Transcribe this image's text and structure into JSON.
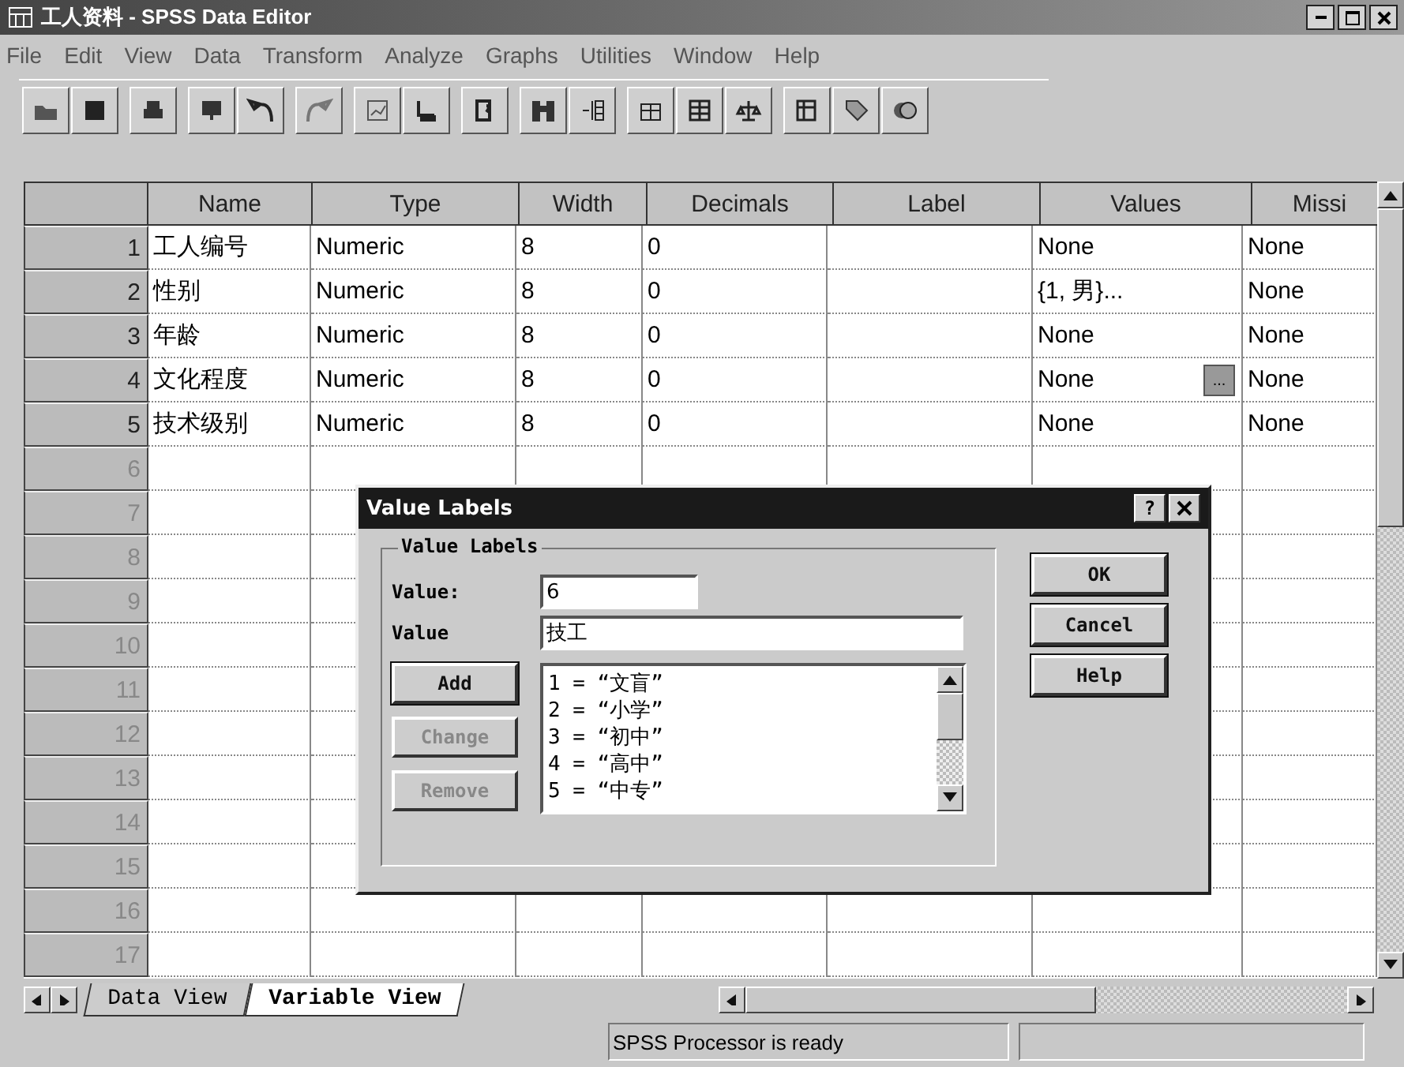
{
  "window": {
    "title": "工人资料 - SPSS Data Editor"
  },
  "menu": [
    "File",
    "Edit",
    "View",
    "Data",
    "Transform",
    "Analyze",
    "Graphs",
    "Utilities",
    "Window",
    "Help"
  ],
  "table": {
    "columns": [
      "Name",
      "Type",
      "Width",
      "Decimals",
      "Label",
      "Values",
      "Missi"
    ],
    "rows": [
      {
        "number": "1",
        "cells": [
          "工人编号",
          "Numeric",
          "8",
          "0",
          "",
          "None",
          "None"
        ]
      },
      {
        "number": "2",
        "cells": [
          "性别",
          "Numeric",
          "8",
          "0",
          "",
          "{1, 男}...",
          "None"
        ]
      },
      {
        "number": "3",
        "cells": [
          "年龄",
          "Numeric",
          "8",
          "0",
          "",
          "None",
          "None"
        ]
      },
      {
        "number": "4",
        "cells": [
          "文化程度",
          "Numeric",
          "8",
          "0",
          "",
          "None",
          "None"
        ],
        "button": "..."
      },
      {
        "number": "5",
        "cells": [
          "技术级别",
          "Numeric",
          "8",
          "0",
          "",
          "None",
          "None"
        ]
      },
      {
        "number": "6",
        "cells": []
      },
      {
        "number": "7",
        "cells": []
      },
      {
        "number": "8",
        "cells": []
      },
      {
        "number": "9",
        "cells": []
      },
      {
        "number": "10",
        "cells": []
      },
      {
        "number": "11",
        "cells": []
      },
      {
        "number": "12",
        "cells": []
      },
      {
        "number": "13",
        "cells": []
      },
      {
        "number": "14",
        "cells": []
      },
      {
        "number": "15",
        "cells": []
      },
      {
        "number": "16",
        "cells": []
      },
      {
        "number": "17",
        "cells": []
      }
    ]
  },
  "tabs": [
    {
      "label": "Data View",
      "selected": false
    },
    {
      "label": "Variable View",
      "selected": true
    }
  ],
  "status_bar": "SPSS Processor  is ready",
  "dialog": {
    "title": "Value Labels",
    "help": "?",
    "group": "Value Labels",
    "value_label": "Value:",
    "value": "6",
    "label_label": "Value",
    "label": "技工",
    "side_buttons": [
      {
        "label": "Add",
        "disabled": false
      },
      {
        "label": "Change",
        "disabled": true
      },
      {
        "label": "Remove",
        "disabled": true
      }
    ],
    "list": [
      "1 = “文盲”",
      "2 = “小学”",
      "3 = “初中”",
      "4 = “高中”",
      "5 = “中专”"
    ],
    "buttons": [
      "OK",
      "Cancel",
      "Help"
    ]
  }
}
